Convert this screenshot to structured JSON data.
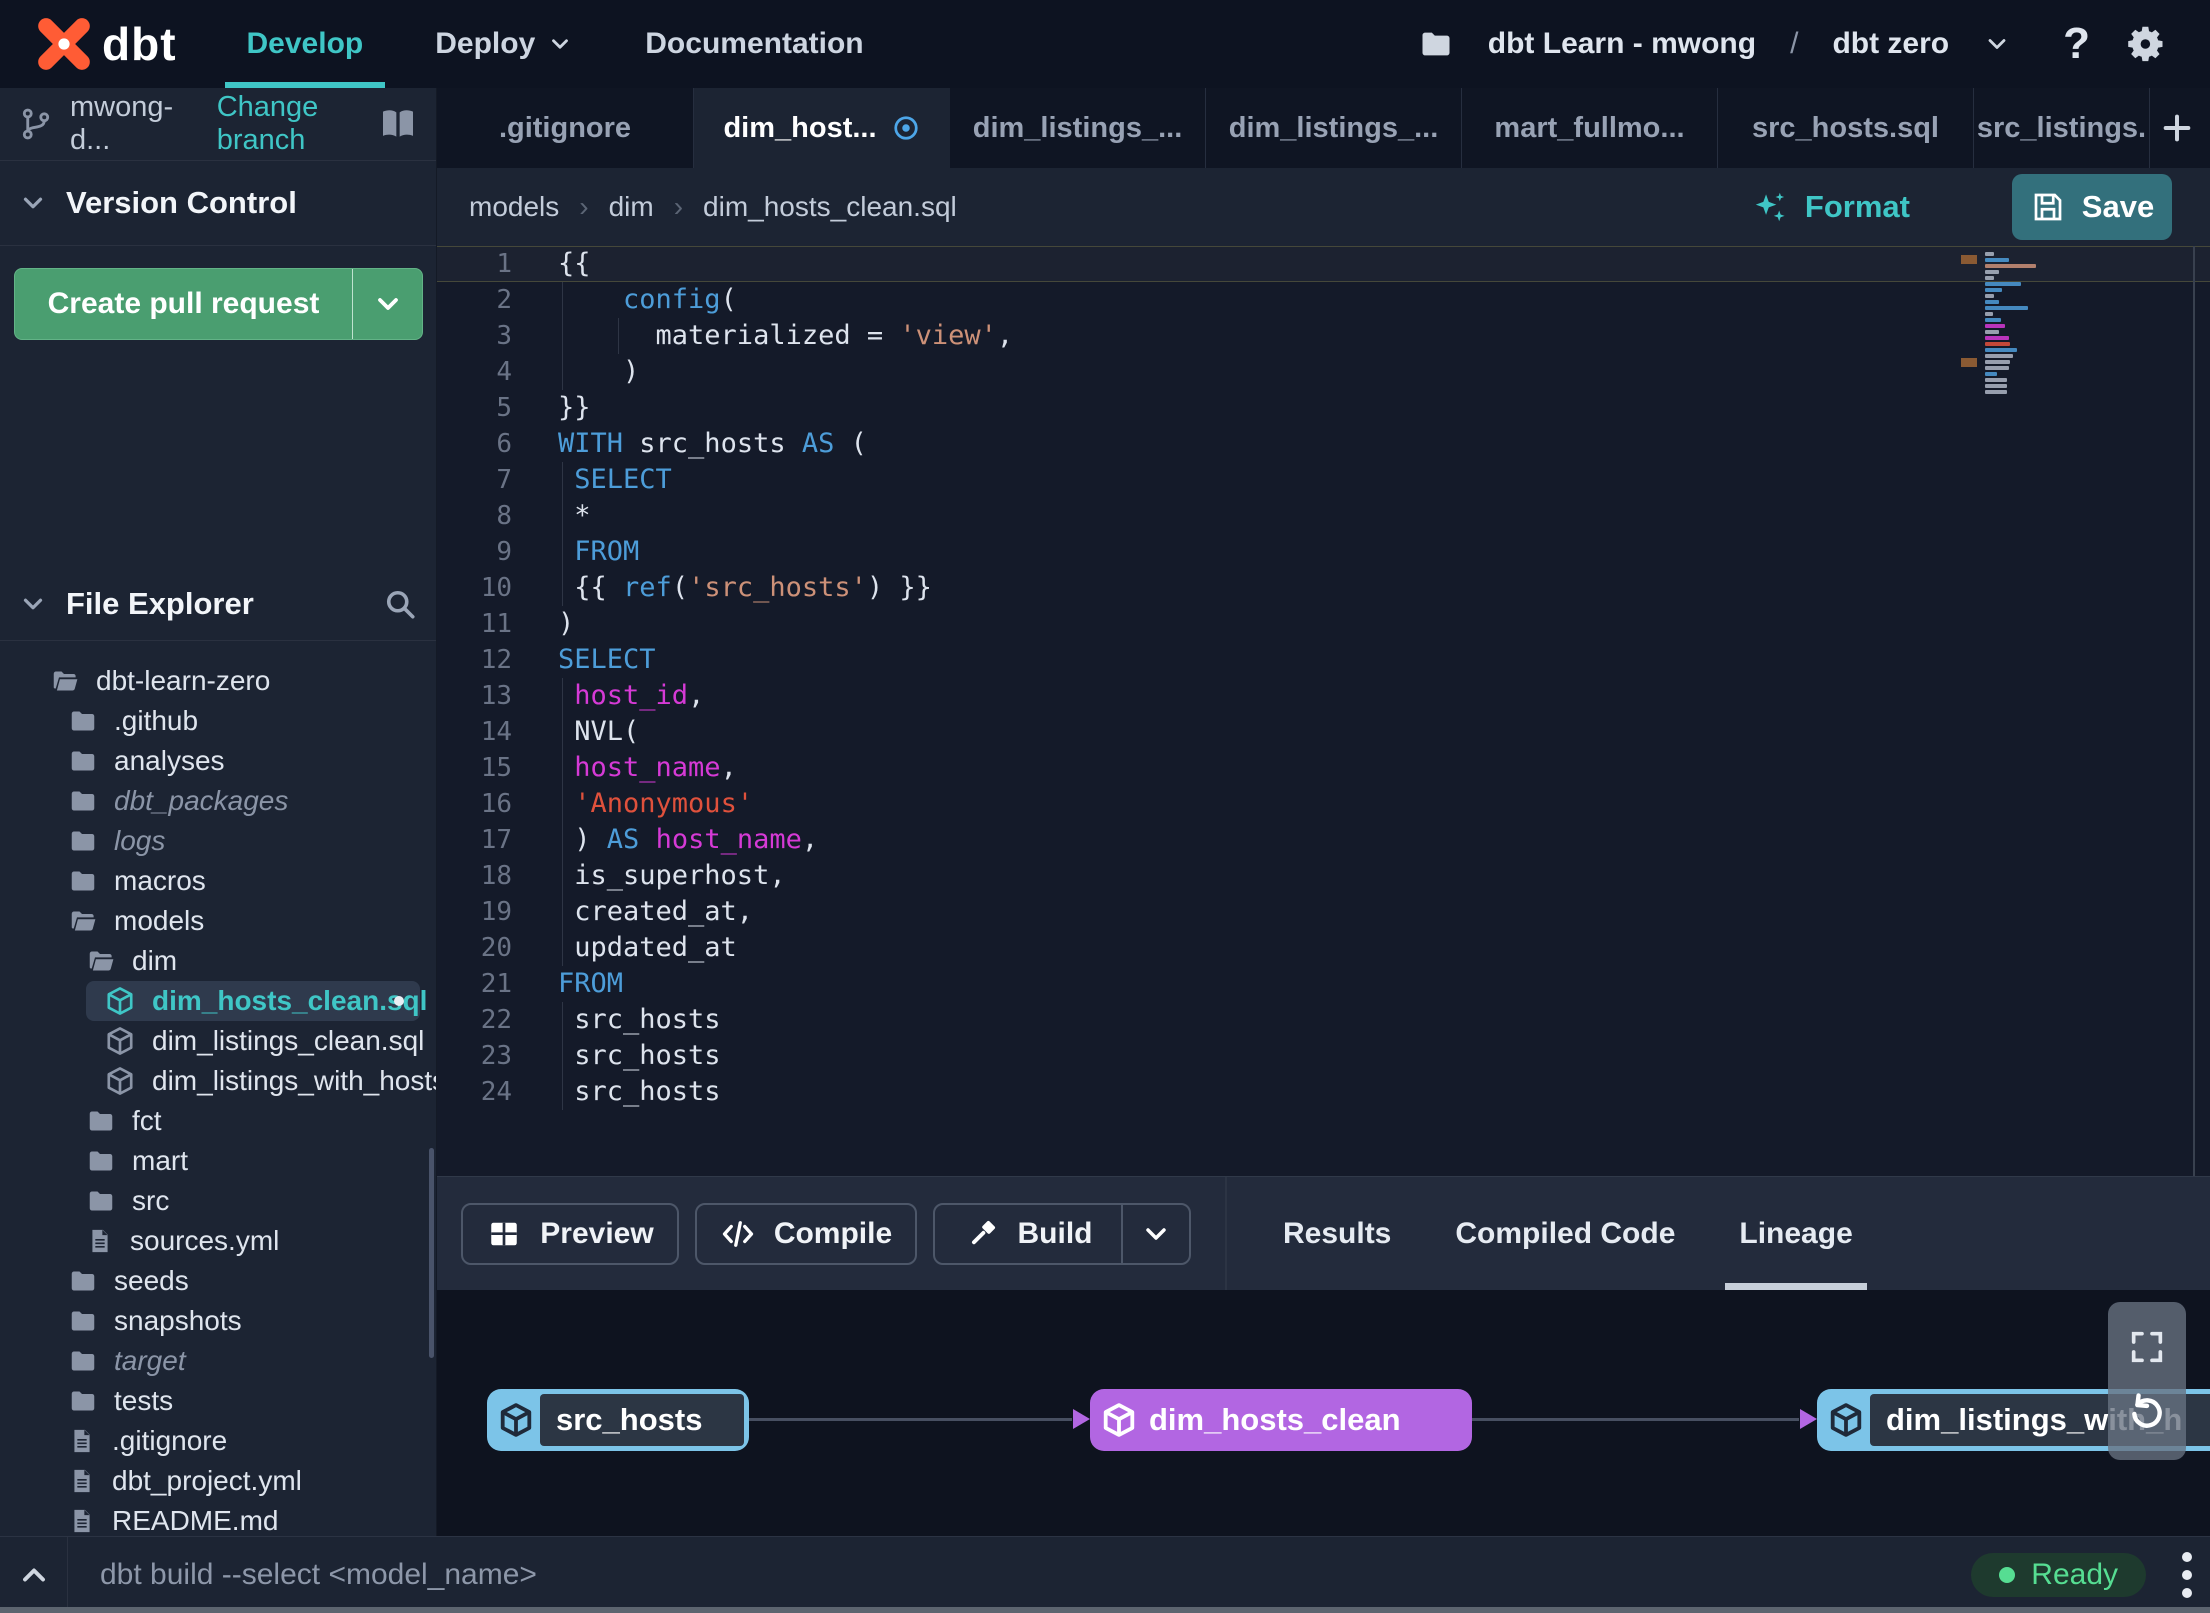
{
  "topbar": {
    "logo": "dbt",
    "nav": [
      {
        "label": "Develop",
        "active": true
      },
      {
        "label": "Deploy",
        "dropdown": true
      },
      {
        "label": "Documentation"
      }
    ],
    "project_label": "dbt Learn - mwong",
    "project_separator": "/",
    "env_label": "dbt zero",
    "help_glyph": "?"
  },
  "sidebar": {
    "branch_name": "mwong-d...",
    "change_branch_label": "Change branch",
    "version_control_title": "Version Control",
    "create_pr_label": "Create pull request",
    "file_explorer_title": "File Explorer",
    "tree": [
      {
        "label": "dbt-learn-zero",
        "depth": 0,
        "icon": "folder-open"
      },
      {
        "label": ".github",
        "depth": 1,
        "icon": "folder"
      },
      {
        "label": "analyses",
        "depth": 1,
        "icon": "folder"
      },
      {
        "label": "dbt_packages",
        "depth": 1,
        "icon": "folder",
        "italic": true
      },
      {
        "label": "logs",
        "depth": 1,
        "icon": "folder",
        "italic": true
      },
      {
        "label": "macros",
        "depth": 1,
        "icon": "folder"
      },
      {
        "label": "models",
        "depth": 1,
        "icon": "folder-open"
      },
      {
        "label": "dim",
        "depth": 2,
        "icon": "folder-open"
      },
      {
        "label": "dim_hosts_clean.sql",
        "depth": 3,
        "icon": "cube",
        "selected": true,
        "modified": true
      },
      {
        "label": "dim_listings_clean.sql",
        "depth": 3,
        "icon": "cube"
      },
      {
        "label": "dim_listings_with_hosts...",
        "depth": 3,
        "icon": "cube"
      },
      {
        "label": "fct",
        "depth": 2,
        "icon": "folder"
      },
      {
        "label": "mart",
        "depth": 2,
        "icon": "folder"
      },
      {
        "label": "src",
        "depth": 2,
        "icon": "folder"
      },
      {
        "label": "sources.yml",
        "depth": 2,
        "icon": "file"
      },
      {
        "label": "seeds",
        "depth": 1,
        "icon": "folder"
      },
      {
        "label": "snapshots",
        "depth": 1,
        "icon": "folder"
      },
      {
        "label": "target",
        "depth": 1,
        "icon": "folder",
        "italic": true
      },
      {
        "label": "tests",
        "depth": 1,
        "icon": "folder"
      },
      {
        "label": ".gitignore",
        "depth": 1,
        "icon": "file"
      },
      {
        "label": "dbt_project.yml",
        "depth": 1,
        "icon": "file"
      },
      {
        "label": "README.md",
        "depth": 1,
        "icon": "file"
      }
    ]
  },
  "tabs": [
    {
      "label": ".gitignore"
    },
    {
      "label": "dim_host...",
      "active": true,
      "modified": true
    },
    {
      "label": "dim_listings_..."
    },
    {
      "label": "dim_listings_..."
    },
    {
      "label": "mart_fullmo..."
    },
    {
      "label": "src_hosts.sql"
    },
    {
      "label": "src_listings."
    }
  ],
  "editor": {
    "breadcrumb": [
      "models",
      "dim",
      "dim_hosts_clean.sql"
    ],
    "format_label": "Format",
    "save_label": "Save",
    "code_lines": [
      [
        [
          "p",
          "{{"
        ]
      ],
      [
        [
          "p",
          "    "
        ],
        [
          "k",
          "config"
        ],
        [
          "p",
          "("
        ]
      ],
      [
        [
          "p",
          "      materialized = "
        ],
        [
          "s",
          "'view'"
        ],
        [
          "p",
          ","
        ]
      ],
      [
        [
          "p",
          "    )"
        ]
      ],
      [
        [
          "p",
          "}}"
        ]
      ],
      [
        [
          "k",
          "WITH"
        ],
        [
          "p",
          " src_hosts "
        ],
        [
          "k",
          "AS"
        ],
        [
          "p",
          " ("
        ]
      ],
      [
        [
          "p",
          " "
        ],
        [
          "k",
          "SELECT"
        ]
      ],
      [
        [
          "p",
          " *"
        ]
      ],
      [
        [
          "p",
          " "
        ],
        [
          "k",
          "FROM"
        ]
      ],
      [
        [
          "p",
          " {{ "
        ],
        [
          "k",
          "ref"
        ],
        [
          "p",
          "("
        ],
        [
          "s",
          "'src_hosts'"
        ],
        [
          "p",
          ") }}"
        ]
      ],
      [
        [
          "p",
          ")"
        ]
      ],
      [
        [
          "k",
          "SELECT"
        ]
      ],
      [
        [
          "p",
          " "
        ],
        [
          "m",
          "host_id"
        ],
        [
          "p",
          ","
        ]
      ],
      [
        [
          "p",
          " NVL("
        ]
      ],
      [
        [
          "p",
          " "
        ],
        [
          "m",
          "host_name"
        ],
        [
          "p",
          ","
        ]
      ],
      [
        [
          "p",
          " "
        ],
        [
          "r",
          "'Anonymous'"
        ]
      ],
      [
        [
          "p",
          " ) "
        ],
        [
          "k",
          "AS"
        ],
        [
          "p",
          " "
        ],
        [
          "m",
          "host_name"
        ],
        [
          "p",
          ","
        ]
      ],
      [
        [
          "p",
          " is_superhost,"
        ]
      ],
      [
        [
          "p",
          " created_at,"
        ]
      ],
      [
        [
          "p",
          " updated_at"
        ]
      ],
      [
        [
          "k",
          "FROM"
        ]
      ],
      [
        [
          "p",
          " src_hosts"
        ]
      ],
      [
        [
          "p",
          " src_hosts"
        ]
      ],
      [
        [
          "p",
          " src_hosts"
        ]
      ]
    ]
  },
  "panel": {
    "buttons": [
      {
        "label": "Preview",
        "icon": "grid"
      },
      {
        "label": "Compile",
        "icon": "code"
      },
      {
        "label": "Build",
        "icon": "hammer",
        "split": true
      }
    ],
    "tabs": [
      {
        "label": "Results"
      },
      {
        "label": "Compiled Code"
      },
      {
        "label": "Lineage",
        "active": true
      }
    ]
  },
  "lineage": {
    "nodes": [
      {
        "label": "src_hosts",
        "style": "blue"
      },
      {
        "label": "dim_hosts_clean",
        "style": "purple"
      },
      {
        "label": "dim_listings_with_h",
        "style": "blue"
      }
    ]
  },
  "statusbar": {
    "command": "dbt build --select <model_name>",
    "status": "Ready"
  },
  "colors": {
    "accent_teal": "#3fc6c6",
    "create_pr_green": "#4a9e70",
    "save_teal": "#33707c",
    "node_blue": "#7cc4e8",
    "node_purple": "#b266e2",
    "keyword_blue": "#4d9dd9",
    "string_salmon": "#cd9178",
    "string_red": "#e0513c",
    "identifier_magenta": "#d63ad6",
    "status_green": "#56dd92"
  }
}
